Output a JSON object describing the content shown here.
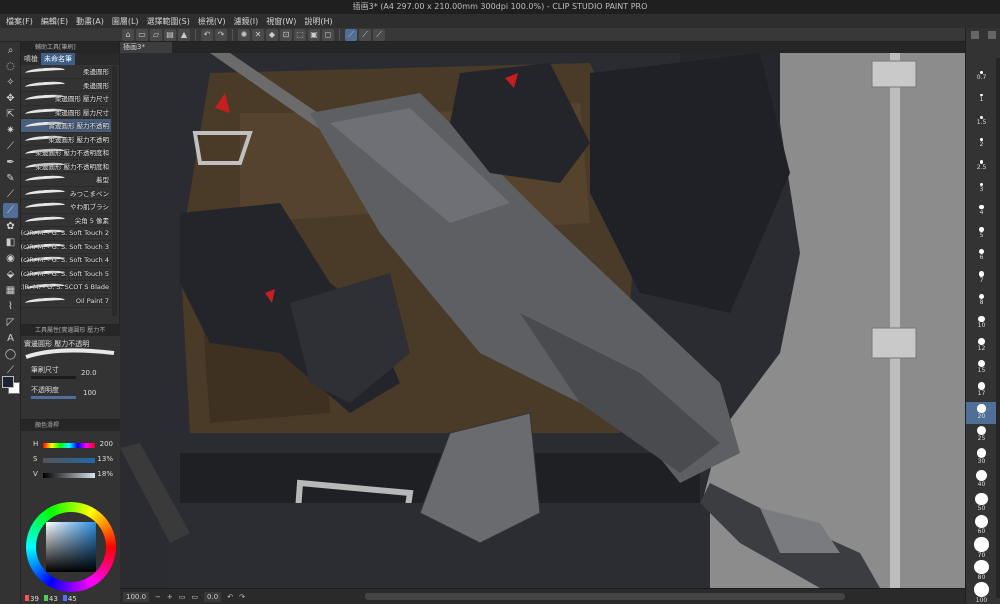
{
  "window": {
    "title": "插画3* (A4 297.00 x 210.00mm 300dpi 100.0%) - CLIP STUDIO PAINT PRO"
  },
  "menu": [
    "檔案(F)",
    "編輯(E)",
    "動畫(A)",
    "圖層(L)",
    "選擇範圍(S)",
    "檢視(V)",
    "濾鏡(I)",
    "視窗(W)",
    "說明(H)"
  ],
  "canvas_tab": "插画3*",
  "subtool_panel": {
    "title": "輔助工具[筆刷]",
    "tabs": [
      {
        "label": "噴槍"
      },
      {
        "label": "未命名筆"
      }
    ],
    "brushes": [
      "柔邊圓形",
      "柔邊圓形",
      "柔邊圓形 壓力尺寸",
      "柔邊圓形 壓力尺寸",
      "實邊圓形 壓力不透明",
      "柔邊圓形 壓力不透明",
      "柔邊圓形 壓力不透明度和",
      "柔邊圓形 壓力不透明度和",
      "着型",
      "みつこまペン",
      "やわ肌ブラシ",
      "尖角 5 像素",
      "(c)R. M. - G. S. Soft Touch 2",
      "(c)R. M. - G. S. Soft Touch 3",
      "(c)R. M. - G. S. Soft Touch 4",
      "(c)R. M. - G. S. Soft Touch 5",
      "(c)R. M. - G. S. SCOT S Blade",
      "Oil Paint 7"
    ],
    "selected_index": 4
  },
  "tool_property": {
    "title": "工具屬性[實邊圓形 壓力不",
    "brush_name": "實邊圓形 壓力不透明",
    "brush_size_label": "筆刷尺寸",
    "brush_size_value": "20.0",
    "opacity_label": "不透明度",
    "opacity_value": "100"
  },
  "color_panel": {
    "title": "顏色滑桿",
    "h": {
      "label": "H",
      "value": "200",
      "level": 0.56
    },
    "s": {
      "label": "S",
      "value": "13",
      "unit": "%",
      "level": 0.13
    },
    "v": {
      "label": "V",
      "value": "18",
      "unit": "%",
      "level": 0.18
    },
    "rgb": [
      {
        "value": "39",
        "color": "#ff5050"
      },
      {
        "value": "43",
        "color": "#50d050"
      },
      {
        "value": "45",
        "color": "#5070ff"
      }
    ],
    "main_color": "#1d2330"
  },
  "status": {
    "zoom": "100.0",
    "angle": "0.0"
  },
  "brush_sizes": {
    "values": [
      "0.7",
      "1",
      "1.5",
      "2",
      "2.5",
      "3",
      "4",
      "5",
      "6",
      "7",
      "8",
      "10",
      "12",
      "15",
      "17",
      "20",
      "25",
      "30",
      "40",
      "50",
      "60",
      "70",
      "80",
      "100"
    ],
    "selected": "20"
  },
  "colors": {
    "accent": "#4f6e98",
    "canvas_bg": "#8e8e8e",
    "vest": "#4a3a28",
    "fabric": "#2a2c31"
  }
}
